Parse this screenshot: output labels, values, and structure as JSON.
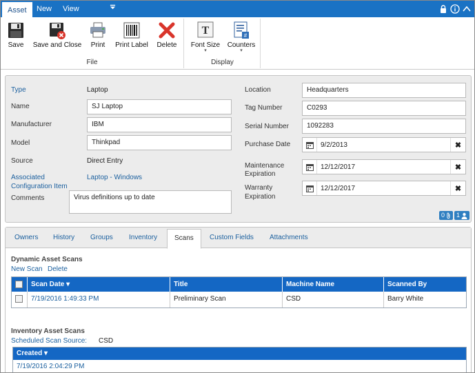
{
  "menu": {
    "tabs": [
      {
        "label": "Asset",
        "active": true
      },
      {
        "label": "New",
        "active": false
      },
      {
        "label": "View",
        "active": false
      }
    ],
    "right_icons": [
      "lock-icon",
      "info-icon",
      "collapse-icon"
    ]
  },
  "ribbon": {
    "file_group": {
      "label": "File",
      "buttons": [
        {
          "label": "Save",
          "icon": "floppy-icon"
        },
        {
          "label": "Save and Close",
          "icon": "floppy-close-icon"
        },
        {
          "label": "Print",
          "icon": "printer-icon"
        },
        {
          "label": "Print Label",
          "icon": "barcode-icon"
        },
        {
          "label": "Delete",
          "icon": "delete-x-icon"
        }
      ]
    },
    "display_group": {
      "label": "Display",
      "buttons": [
        {
          "label": "Font Size",
          "icon": "font-icon"
        },
        {
          "label": "Counters",
          "icon": "counters-icon"
        }
      ]
    }
  },
  "details": {
    "type_label": "Type",
    "type_value": "Laptop",
    "name_label": "Name",
    "name_value": "SJ Laptop",
    "manufacturer_label": "Manufacturer",
    "manufacturer_value": "IBM",
    "model_label": "Model",
    "model_value": "Thinkpad",
    "source_label": "Source",
    "source_value": "Direct Entry",
    "aci_label_1": "Associated",
    "aci_label_2": "Configuration Item",
    "aci_value": "Laptop - Windows",
    "comments_label": "Comments",
    "comments_value": "Virus definitions up to date",
    "location_label": "Location",
    "location_value": "Headquarters",
    "tag_label": "Tag Number",
    "tag_value": "C0293",
    "serial_label": "Serial Number",
    "serial_value": "1092283",
    "purchase_label": "Purchase Date",
    "purchase_value": "9/2/2013",
    "maint_label_1": "Maintenance",
    "maint_label_2": "Expiration",
    "maint_value": "12/12/2017",
    "warranty_label_1": "Warranty",
    "warranty_label_2": "Expiration",
    "warranty_value": "12/12/2017",
    "badge_attachments": "0",
    "badge_users": "1"
  },
  "tabs": {
    "items": [
      {
        "label": "Owners"
      },
      {
        "label": "History"
      },
      {
        "label": "Groups"
      },
      {
        "label": "Inventory"
      },
      {
        "label": "Scans",
        "active": true
      },
      {
        "label": "Custom Fields"
      },
      {
        "label": "Attachments"
      }
    ]
  },
  "scans": {
    "dynamic_title": "Dynamic Asset Scans",
    "new_scan": "New Scan",
    "delete": "Delete",
    "columns": [
      "Scan Date",
      "Title",
      "Machine Name",
      "Scanned By"
    ],
    "rows": [
      {
        "scan_date": "7/19/2016 1:49:33 PM",
        "title": "Preliminary Scan",
        "machine": "CSD",
        "scanned_by": "Barry White"
      }
    ],
    "inventory_title": "Inventory Asset Scans",
    "scheduled_label": "Scheduled Scan Source:",
    "scheduled_value": "CSD",
    "inv_columns": [
      "Created"
    ],
    "inv_rows": [
      {
        "created": "7/19/2016 2:04:29 PM"
      }
    ]
  },
  "colors": {
    "accent": "#1a72c4",
    "grid_header": "#1467c4",
    "link": "#1a5f9e",
    "panel_bg": "#ececec"
  }
}
